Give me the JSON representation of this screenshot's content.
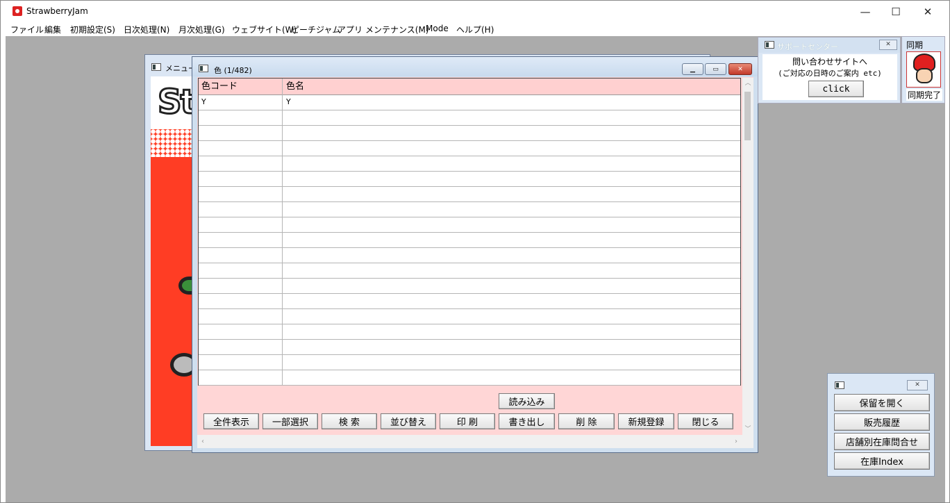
{
  "app": {
    "title": "StrawberryJam"
  },
  "window_controls": {
    "minimize": "—",
    "maximize": "☐",
    "close": "✕"
  },
  "menubar": [
    "ファイル",
    "編集",
    "初期設定(S)",
    "日次処理(N)",
    "月次処理(G)",
    "ウェブサイト(W)",
    "ピーチジャム",
    "アプリ",
    "メンテナンス(M)",
    "Mode",
    "ヘルプ(H)"
  ],
  "menu_window": {
    "title": "メニュー"
  },
  "color_window": {
    "title": "色 (1/482)",
    "columns": [
      "色コード",
      "色名"
    ],
    "rows": [
      {
        "code": "Y",
        "name": "Y"
      },
      {
        "code": "",
        "name": ""
      },
      {
        "code": "",
        "name": ""
      },
      {
        "code": "",
        "name": ""
      },
      {
        "code": "",
        "name": ""
      },
      {
        "code": "",
        "name": ""
      },
      {
        "code": "",
        "name": ""
      },
      {
        "code": "",
        "name": ""
      },
      {
        "code": "",
        "name": ""
      },
      {
        "code": "",
        "name": ""
      },
      {
        "code": "",
        "name": ""
      },
      {
        "code": "",
        "name": ""
      },
      {
        "code": "",
        "name": ""
      },
      {
        "code": "",
        "name": ""
      },
      {
        "code": "",
        "name": ""
      },
      {
        "code": "",
        "name": ""
      },
      {
        "code": "",
        "name": ""
      },
      {
        "code": "",
        "name": ""
      },
      {
        "code": "",
        "name": ""
      }
    ],
    "buttons": {
      "load": "読み込み",
      "show_all": "全件表示",
      "partial_select": "一部選択",
      "search": "検 索",
      "sort": "並び替え",
      "print": "印 刷",
      "export": "書き出し",
      "delete": "削 除",
      "new": "新規登録",
      "close": "閉じる"
    }
  },
  "support_center": {
    "title": "サポートセンター",
    "line1": "問い合わせサイトへ",
    "line2": "(ご対応の日時のご案内 etc)",
    "button": "click"
  },
  "sync": {
    "label": "同期",
    "status": "同期完了"
  },
  "hold_panel": {
    "buttons": [
      "保留を開く",
      "販売履歴",
      "店舗別在庫問合せ",
      "在庫Index"
    ]
  }
}
